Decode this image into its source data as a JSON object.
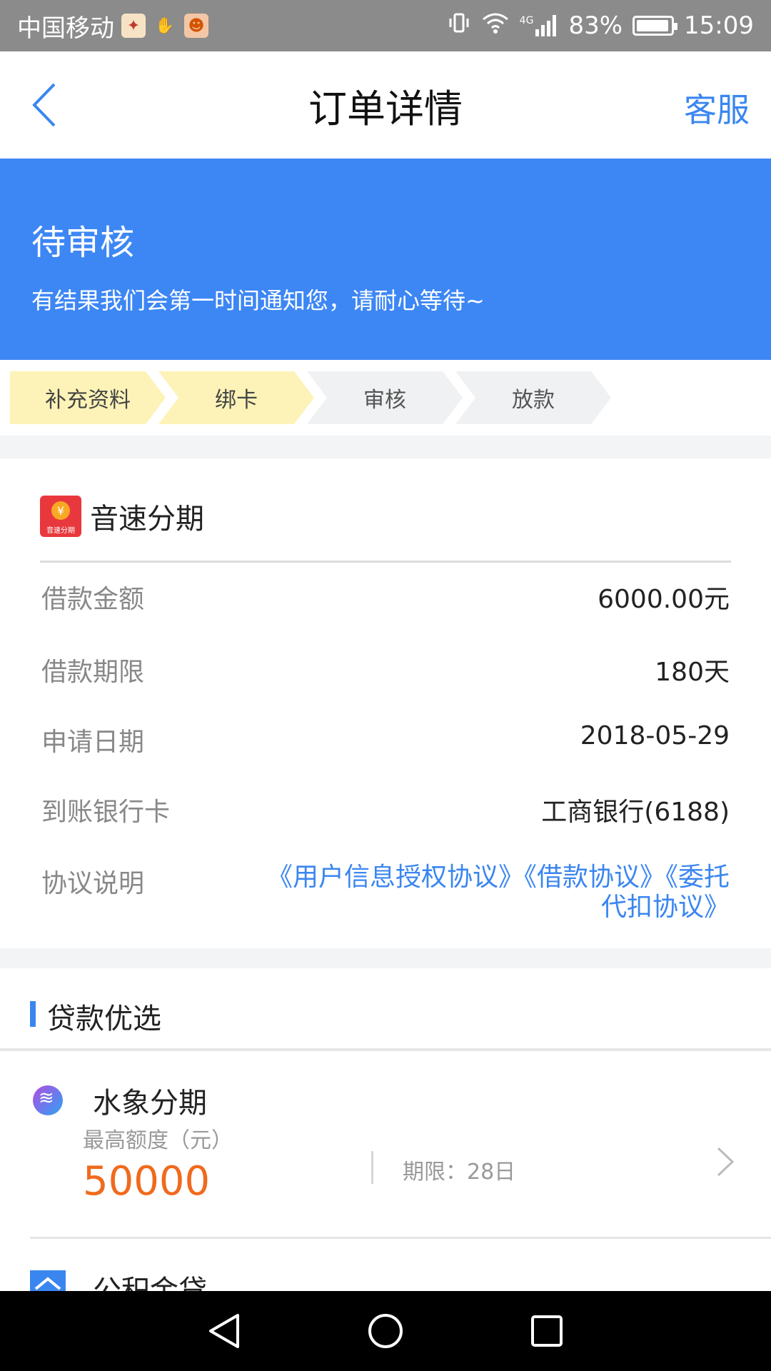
{
  "status_bar": {
    "carrier": "中国移动",
    "network": "4G",
    "battery": "83%",
    "time": "15:09"
  },
  "nav": {
    "title": "订单详情",
    "service": "客服"
  },
  "banner": {
    "status": "待审核",
    "description": "有结果我们会第一时间通知您，请耐心等待~"
  },
  "steps": [
    {
      "label": "补充资料",
      "state": "done"
    },
    {
      "label": "绑卡",
      "state": "done"
    },
    {
      "label": "审核",
      "state": "todo"
    },
    {
      "label": "放款",
      "state": "todo"
    }
  ],
  "order": {
    "app_name": "音速分期",
    "logo_text": "音速分期",
    "logo_coin": "¥",
    "rows": [
      {
        "label": "借款金额",
        "value": "6000.00元"
      },
      {
        "label": "借款期限",
        "value": "180天"
      },
      {
        "label": "申请日期",
        "value": "2018-05-29"
      },
      {
        "label": "到账银行卡",
        "value": "工商银行(6188)"
      }
    ],
    "agreement_label": "协议说明",
    "agreements": "《用户信息授权协议》《借款协议》《委托代扣协议》"
  },
  "recommend": {
    "title": "贷款优选",
    "items": [
      {
        "name": "水象分期",
        "limit_label": "最高额度（元）",
        "amount": "50000",
        "term": "期限：28日"
      },
      {
        "name": "公积金贷"
      }
    ]
  },
  "colors": {
    "accent": "#3a86f0",
    "banner": "#3d87f5",
    "amount": "#f06a1d",
    "step_done": "#fdf3b8",
    "step_todo": "#f0f1f3"
  }
}
